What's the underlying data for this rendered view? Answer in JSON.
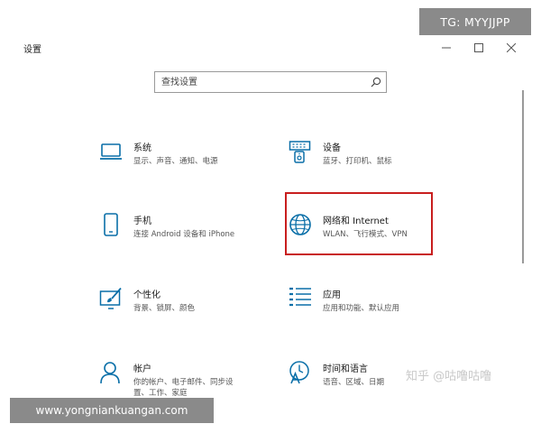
{
  "window": {
    "title": "设置"
  },
  "search": {
    "placeholder": "查找设置"
  },
  "tiles": [
    {
      "name": "系统",
      "desc": "显示、声音、通知、电源",
      "icon": "laptop-icon"
    },
    {
      "name": "设备",
      "desc": "蓝牙、打印机、鼠标",
      "icon": "devices-icon"
    },
    {
      "name": "手机",
      "desc": "连接 Android 设备和 iPhone",
      "icon": "phone-icon"
    },
    {
      "name": "网络和 Internet",
      "desc": "WLAN、飞行模式、VPN",
      "icon": "globe-icon"
    },
    {
      "name": "个性化",
      "desc": "背景、锁屏、颜色",
      "icon": "personalization-icon"
    },
    {
      "name": "应用",
      "desc": "应用和功能、默认应用",
      "icon": "apps-list-icon"
    },
    {
      "name": "帐户",
      "desc": "你的帐户、电子邮件、同步设\n置、工作、家庭",
      "icon": "person-icon"
    },
    {
      "name": "时间和语言",
      "desc": "语音、区域、日期",
      "icon": "time-language-icon"
    }
  ],
  "colors": {
    "accent": "#0a6fa8",
    "highlight": "#c81e1e"
  },
  "watermarks": {
    "tg": "TG: MYYJJPP",
    "url": "www.yongniankuangan.com",
    "zhihu": "知乎 @咕噜咕噜"
  }
}
